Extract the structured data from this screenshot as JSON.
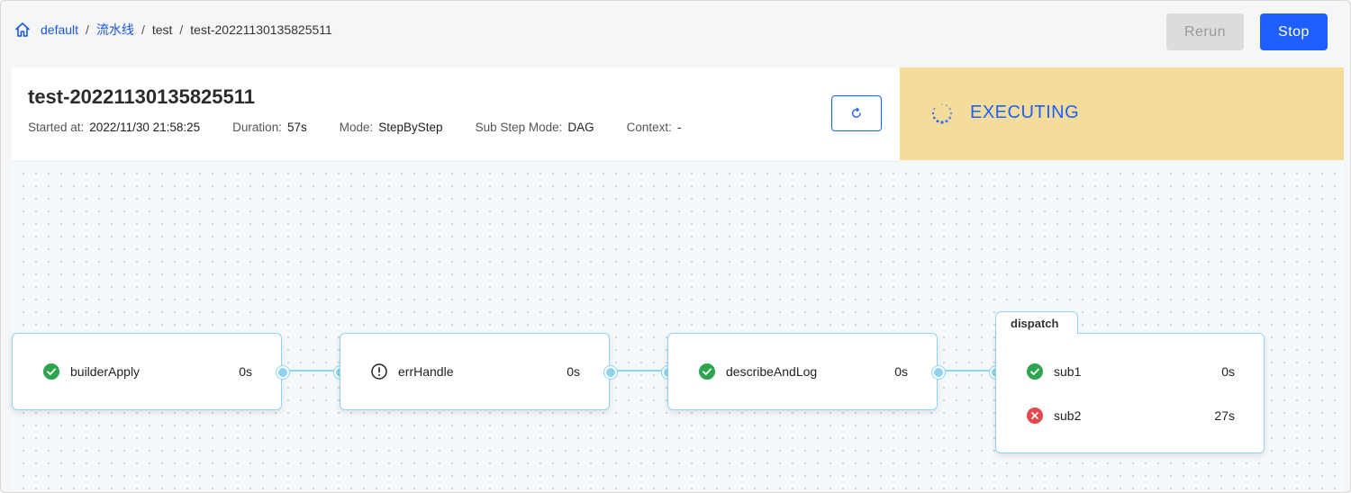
{
  "breadcrumb": {
    "items": [
      {
        "label": "default",
        "link": true
      },
      {
        "label": "流水线",
        "link": true
      },
      {
        "label": "test",
        "link": false
      },
      {
        "label": "test-20221130135825511",
        "link": false
      }
    ],
    "separator": "/"
  },
  "actions": {
    "rerun_label": "Rerun",
    "stop_label": "Stop"
  },
  "run": {
    "title": "test-20221130135825511",
    "meta": [
      {
        "label": "Started at:",
        "value": "2022/11/30 21:58:25"
      },
      {
        "label": "Duration:",
        "value": "57s"
      },
      {
        "label": "Mode:",
        "value": "StepByStep"
      },
      {
        "label": "Sub Step Mode:",
        "value": "DAG"
      },
      {
        "label": "Context:",
        "value": "-"
      }
    ]
  },
  "status": {
    "text": "EXECUTING",
    "color": "#1f5eff",
    "background": "#f4dd9b"
  },
  "steps": [
    {
      "name": "builderApply",
      "duration": "0s",
      "status": "succeeded",
      "icon": "check-circle-icon"
    },
    {
      "name": "errHandle",
      "duration": "0s",
      "status": "warning",
      "icon": "exclamation-circle-icon"
    },
    {
      "name": "describeAndLog",
      "duration": "0s",
      "status": "succeeded",
      "icon": "check-circle-icon"
    }
  ],
  "group": {
    "name": "dispatch",
    "substeps": [
      {
        "name": "sub1",
        "duration": "0s",
        "status": "succeeded",
        "icon": "check-circle-icon"
      },
      {
        "name": "sub2",
        "duration": "27s",
        "status": "failed",
        "icon": "x-circle-icon"
      }
    ]
  },
  "colors": {
    "accent": "#1f5eff",
    "success": "#2ea44f",
    "error": "#e5484d",
    "edge": "#8ed4f0"
  }
}
